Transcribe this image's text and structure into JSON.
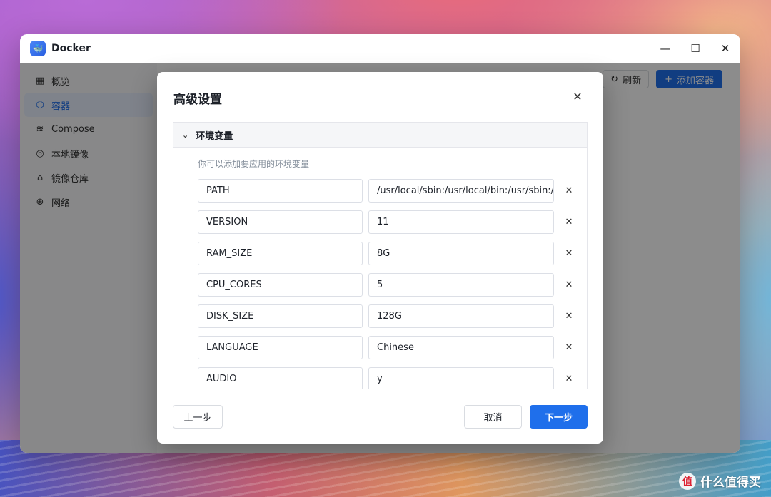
{
  "window": {
    "title": "Docker",
    "controls": {
      "minimize": "—",
      "maximize": "☐",
      "close": "✕"
    }
  },
  "sidebar": {
    "items": [
      {
        "label": "概览",
        "icon": "grid-icon",
        "glyph": "▦"
      },
      {
        "label": "容器",
        "icon": "cube-icon",
        "glyph": "⬡",
        "active": true
      },
      {
        "label": "Compose",
        "icon": "layers-icon",
        "glyph": "≋"
      },
      {
        "label": "本地镜像",
        "icon": "disc-icon",
        "glyph": "◎"
      },
      {
        "label": "镜像仓库",
        "icon": "home-icon",
        "glyph": "⌂"
      },
      {
        "label": "网络",
        "icon": "globe-icon",
        "glyph": "⊕"
      }
    ]
  },
  "toolbar": {
    "refresh_label": "刷新",
    "refresh_glyph": "↻",
    "add_label": "添加容器",
    "add_glyph": "+"
  },
  "dialog": {
    "title": "高级设置",
    "close_glyph": "✕",
    "section": {
      "title": "环境变量",
      "chevron": "⌄",
      "description": "你可以添加要应用的环境变量",
      "delete_glyph": "✕",
      "env": [
        {
          "key": "PATH",
          "value": "/usr/local/sbin:/usr/local/bin:/usr/sbin:/usr/bin:/sbin:/bin"
        },
        {
          "key": "VERSION",
          "value": "11"
        },
        {
          "key": "RAM_SIZE",
          "value": "8G"
        },
        {
          "key": "CPU_CORES",
          "value": "5"
        },
        {
          "key": "DISK_SIZE",
          "value": "128G"
        },
        {
          "key": "LANGUAGE",
          "value": "Chinese"
        },
        {
          "key": "AUDIO",
          "value": "y"
        }
      ]
    },
    "footer": {
      "prev_label": "上一步",
      "cancel_label": "取消",
      "next_label": "下一步"
    }
  },
  "watermark": {
    "text": "什么值得买",
    "logo": "值"
  }
}
